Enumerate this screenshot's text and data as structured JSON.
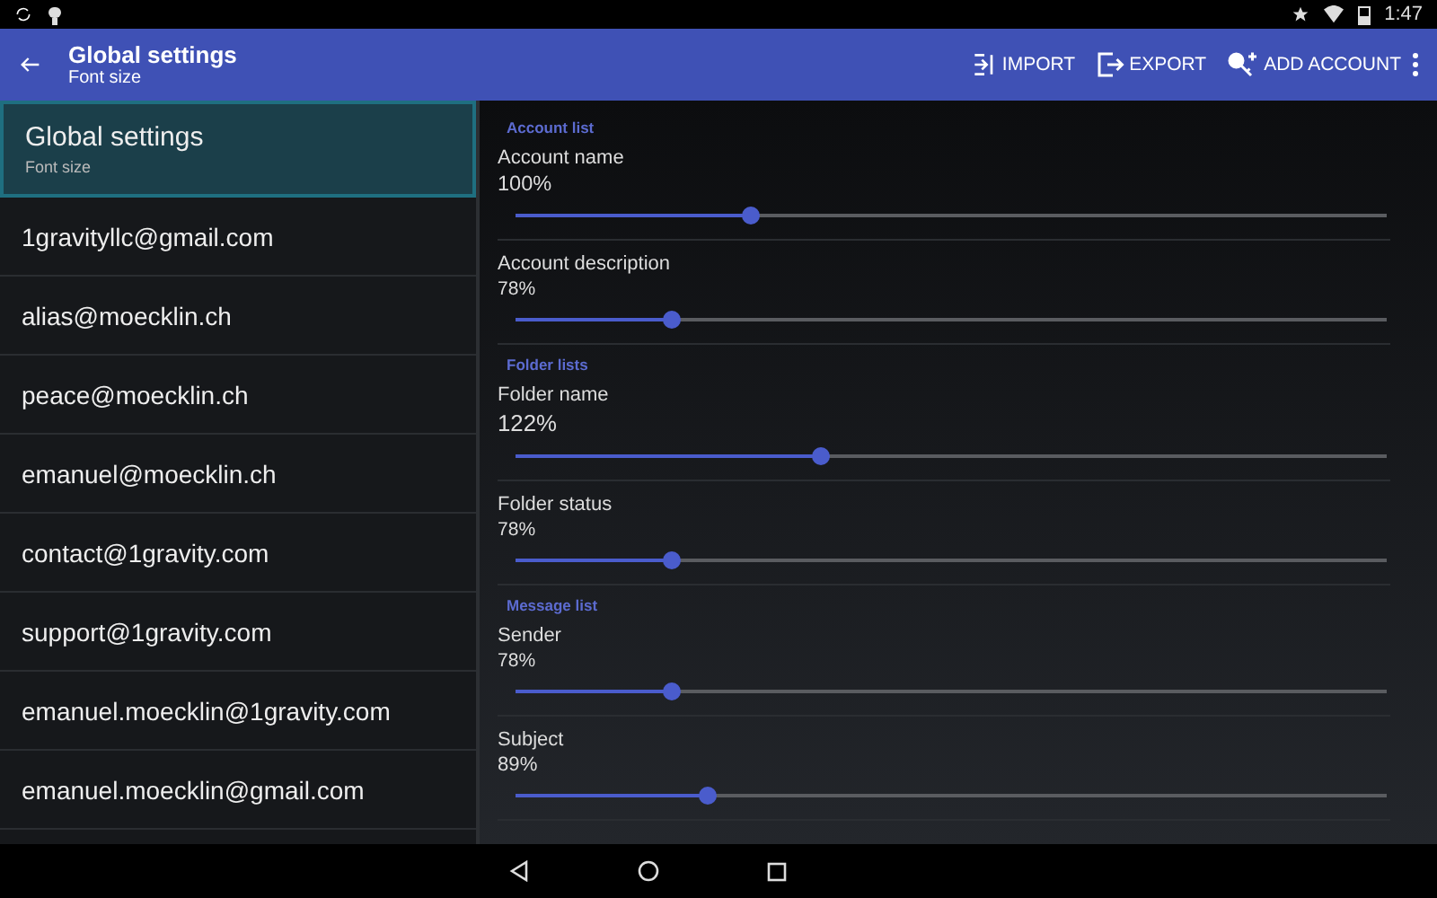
{
  "status_bar": {
    "time": "1:47"
  },
  "toolbar": {
    "title": "Global settings",
    "subtitle": "Font size",
    "actions": [
      {
        "kind": "import",
        "label": "IMPORT"
      },
      {
        "kind": "export",
        "label": "EXPORT"
      },
      {
        "kind": "add-account",
        "label": "ADD ACCOUNT"
      }
    ]
  },
  "sidebar": {
    "items": [
      {
        "title": "Global settings",
        "subtitle": "Font size",
        "selected": true
      },
      {
        "title": "1gravityllc@gmail.com",
        "selected": false
      },
      {
        "title": "alias@moecklin.ch",
        "selected": false
      },
      {
        "title": "peace@moecklin.ch",
        "selected": false
      },
      {
        "title": "emanuel@moecklin.ch",
        "selected": false
      },
      {
        "title": "contact@1gravity.com",
        "selected": false
      },
      {
        "title": "support@1gravity.com",
        "selected": false
      },
      {
        "title": "emanuel.moecklin@1gravity.com",
        "selected": false
      },
      {
        "title": "emanuel.moecklin@gmail.com",
        "selected": false
      }
    ]
  },
  "sections": [
    {
      "title": "Account list",
      "settings": [
        {
          "name": "Account name",
          "value": "100%",
          "level": 0.27
        },
        {
          "name": "Account description",
          "value": "78%",
          "level": 0.18
        }
      ]
    },
    {
      "title": "Folder lists",
      "settings": [
        {
          "name": "Folder name",
          "value": "122%",
          "level": 0.35
        },
        {
          "name": "Folder status",
          "value": "78%",
          "level": 0.18
        }
      ]
    },
    {
      "title": "Message list",
      "settings": [
        {
          "name": "Sender",
          "value": "78%",
          "level": 0.18
        },
        {
          "name": "Subject",
          "value": "89%",
          "level": 0.22
        }
      ]
    }
  ]
}
